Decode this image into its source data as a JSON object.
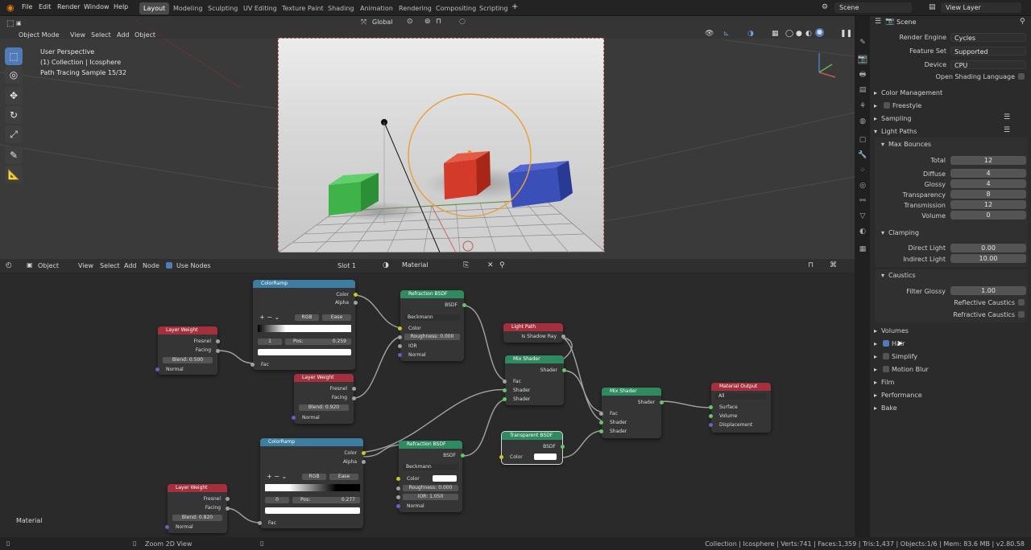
{
  "topbar": {
    "menus": [
      "File",
      "Edit",
      "Render",
      "Window",
      "Help"
    ],
    "workspaces": [
      "Layout",
      "Modeling",
      "Sculpting",
      "UV Editing",
      "Texture Paint",
      "Shading",
      "Animation",
      "Rendering",
      "Compositing",
      "Scripting"
    ],
    "add_tab": "+",
    "scene": "Scene",
    "view_layer": "View Layer"
  },
  "viewport": {
    "mode": "Object Mode",
    "menus": [
      "View",
      "Select",
      "Add",
      "Object"
    ],
    "transform": "Global",
    "overlay_line1": "User Perspective",
    "overlay_line2": "(1) Collection | Icosphere",
    "overlay_line3": "Path Tracing Sample 15/32"
  },
  "node_editor": {
    "editor_type": "Object",
    "menus": [
      "View",
      "Select",
      "Add",
      "Node"
    ],
    "use_nodes": "Use Nodes",
    "slot": "Slot 1",
    "material": "Material",
    "corner_label": "Material",
    "nodes": {
      "lw1": {
        "title": "Layer Weight",
        "out1": "Fresnel",
        "out2": "Facing",
        "blend_label": "Blend:",
        "blend": "0.500",
        "in": "Normal"
      },
      "lw2": {
        "title": "Layer Weight",
        "out1": "Fresnel",
        "out2": "Facing",
        "blend_label": "Blend:",
        "blend": "0.920",
        "in": "Normal"
      },
      "lw3": {
        "title": "Layer Weight",
        "out1": "Fresnel",
        "out2": "Facing",
        "blend_label": "Blend:",
        "blend": "0.820",
        "in": "Normal"
      },
      "cr1": {
        "title": "ColorRamp",
        "out1": "Color",
        "out2": "Alpha",
        "mode": "RGB",
        "interp": "Ease",
        "idx": "1",
        "pos_label": "Pos:",
        "pos": "0.259",
        "in": "Fac"
      },
      "cr2": {
        "title": "ColorRamp",
        "out1": "Color",
        "out2": "Alpha",
        "mode": "RGB",
        "interp": "Ease",
        "idx": "0",
        "pos_label": "Pos:",
        "pos": "0.277",
        "in": "Fac"
      },
      "rb1": {
        "title": "Refraction BSDF",
        "out": "BSDF",
        "dist": "Beckmann",
        "in1": "Color",
        "rough_label": "Roughness:",
        "rough": "0.000",
        "in2": "IOR",
        "in3": "Normal"
      },
      "rb2": {
        "title": "Refraction BSDF",
        "out": "BSDF",
        "dist": "Beckmann",
        "in1": "Color",
        "rough_label": "Roughness:",
        "rough": "0.000",
        "ior_label": "IOR:",
        "ior": "1.050",
        "in3": "Normal"
      },
      "lp": {
        "title": "Light Path",
        "out": "Is Shadow Ray"
      },
      "ms1": {
        "title": "Mix Shader",
        "out": "Shader",
        "in1": "Fac",
        "in2": "Shader",
        "in3": "Shader"
      },
      "ms2": {
        "title": "Mix Shader",
        "out": "Shader",
        "in1": "Fac",
        "in2": "Shader",
        "in3": "Shader"
      },
      "tb": {
        "title": "Transparent BSDF",
        "out": "BSDF",
        "in": "Color"
      },
      "mo": {
        "title": "Material Output",
        "target": "All",
        "in1": "Surface",
        "in2": "Volume",
        "in3": "Displacement"
      }
    }
  },
  "properties": {
    "title": "Scene",
    "render_engine_label": "Render Engine",
    "render_engine": "Cycles",
    "feature_set_label": "Feature Set",
    "feature_set": "Supported",
    "device_label": "Device",
    "device": "CPU",
    "osl_label": "Open Shading Language",
    "sections": {
      "color_management": "Color Management",
      "freestyle": "Freestyle",
      "sampling": "Sampling",
      "light_paths": "Light Paths",
      "max_bounces": "Max Bounces",
      "clamping": "Clamping",
      "caustics": "Caustics",
      "volumes": "Volumes",
      "hair": "Hair",
      "simplify": "Simplify",
      "motion_blur": "Motion Blur",
      "film": "Film",
      "performance": "Performance",
      "bake": "Bake"
    },
    "bounces": [
      {
        "label": "Total",
        "value": "12"
      },
      {
        "label": "Diffuse",
        "value": "4"
      },
      {
        "label": "Glossy",
        "value": "4"
      },
      {
        "label": "Transparency",
        "value": "8"
      },
      {
        "label": "Transmission",
        "value": "12"
      },
      {
        "label": "Volume",
        "value": "0"
      }
    ],
    "direct_light_label": "Direct Light",
    "direct_light": "0.00",
    "indirect_light_label": "Indirect Light",
    "indirect_light": "10.00",
    "filter_glossy_label": "Filter Glossy",
    "filter_glossy": "1.00",
    "reflective_caustics": "Reflective Caustics",
    "refractive_caustics": "Refractive Caustics"
  },
  "statusbar": {
    "hint": "Zoom 2D View",
    "stats": "Collection | Icosphere | Verts:741 | Faces:1,359 | Tris:1,437 | Objects:1/6 | Mem: 83.6 MB | v2.80.58"
  }
}
